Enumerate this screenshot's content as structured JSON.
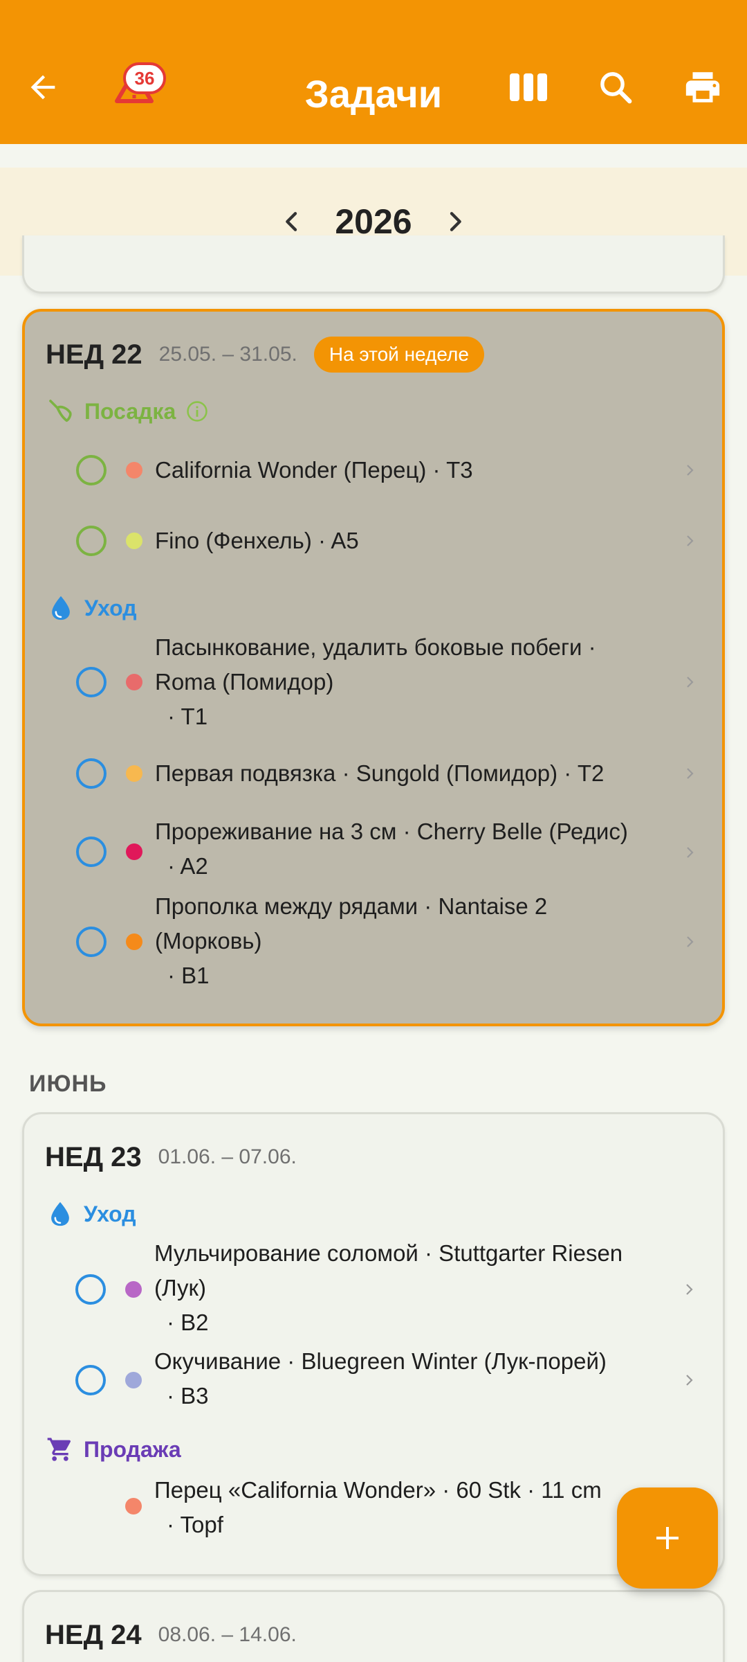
{
  "appbar": {
    "title": "Задачи",
    "warning_count": "36"
  },
  "year": "2026",
  "colors": {
    "accent": "#f39404",
    "care": "#2b8ee0",
    "planting": "#7cb342",
    "sale": "#6a3cb5"
  },
  "weeks": [
    {
      "week": "НЕД 22",
      "dates": "25.05. – 31.05.",
      "badge": "На этой неделе",
      "categories": [
        {
          "label": "Посадка",
          "tasks": [
            {
              "line1": "California Wonder (Перец)  · T3",
              "dot": "#f4866a"
            },
            {
              "line1": "Fino (Фенхель)  · A5",
              "dot": "#dbe36a"
            }
          ]
        },
        {
          "label": "Уход",
          "tasks": [
            {
              "line1": "Пасынкование, удалить боковые побеги ·",
              "line2": "Roma (Помидор)",
              "line3": "· T1",
              "dot": "#e86b6b"
            },
            {
              "line1": "Первая подвязка · Sungold (Помидор)  · T2",
              "dot": "#f7b84f"
            },
            {
              "line1": "Прореживание на 3 см · Cherry Belle (Редис)",
              "line2": "· A2",
              "dot": "#e0185a"
            },
            {
              "line1": "Прополка между рядами · Nantaise 2",
              "line2": "(Морковь)",
              "line3": "· B1",
              "dot": "#f58a1a"
            }
          ]
        }
      ]
    },
    {
      "month": "ИЮНЬ",
      "week": "НЕД 23",
      "dates": "01.06. – 07.06.",
      "categories": [
        {
          "label": "Уход",
          "tasks": [
            {
              "line1": "Мульчирование соломой · Stuttgarter Riesen",
              "line2": "(Лук)",
              "line3": "· B2",
              "dot": "#b867c6"
            },
            {
              "line1": "Окучивание · Bluegreen Winter (Лук-порей)",
              "line2": "· B3",
              "dot": "#9fa8da"
            }
          ]
        },
        {
          "label": "Продажа",
          "tasks": [
            {
              "line1": "Перец «California Wonder» · 60 Stk · 11 cm",
              "line2": "· Topf",
              "dot": "#f4866a"
            }
          ]
        }
      ]
    },
    {
      "week": "НЕД 24",
      "dates": "08.06. – 14.06."
    }
  ]
}
